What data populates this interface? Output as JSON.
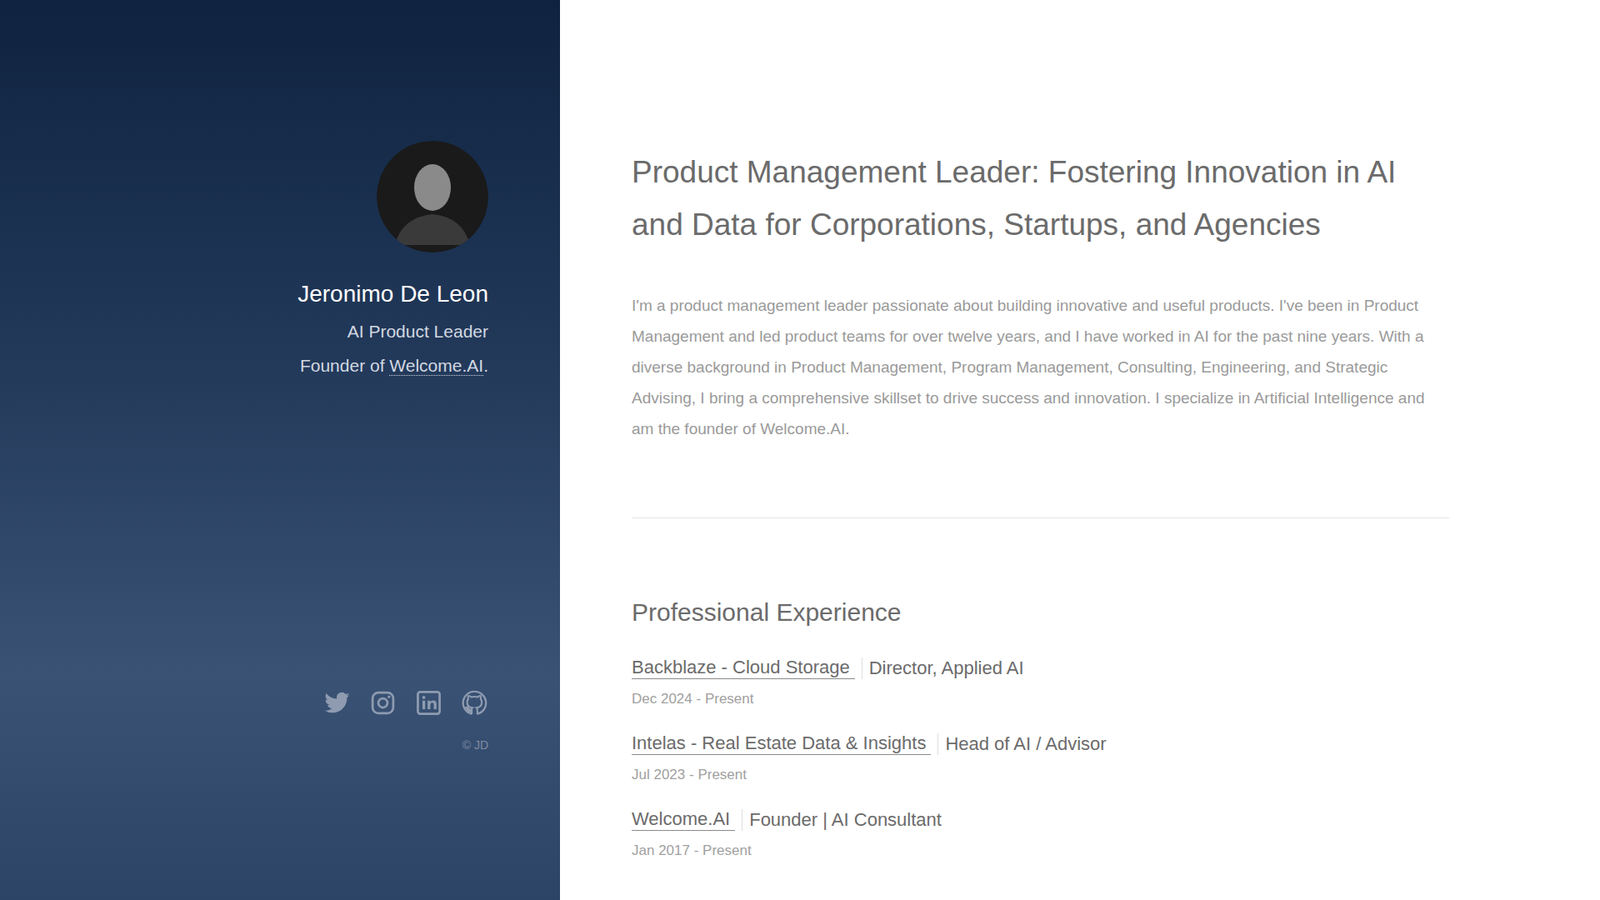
{
  "sidebar": {
    "name": "Jeronimo De Leon",
    "title": "AI Product Leader",
    "founder": {
      "prefix": "Founder of ",
      "link": "Welcome.AI",
      "suffix": "."
    },
    "copyright": "© JD"
  },
  "intro": {
    "heading": "Product Management Leader: Fostering Innovation in AI and Data for Corporations, Startups, and Agencies",
    "text": "I'm a product management leader passionate about building innovative and useful products. I've been in Product Management and led product teams for over twelve years, and I have worked in AI for the past nine years. With a diverse background in Product Management, Program Management, Consulting, Engineering, and Strategic Advising, I bring a comprehensive skillset to drive success and innovation. I specialize in Artificial Intelligence and am the founder of Welcome.AI."
  },
  "experience": {
    "title": "Professional Experience",
    "items": [
      {
        "company": "Backblaze - Cloud Storage",
        "role": "Director, Applied AI",
        "dates": "Dec 2024 - Present"
      },
      {
        "company": "Intelas - Real Estate Data & Insights",
        "role": "Head of AI / Advisor",
        "dates": "Jul 2023 - Present"
      },
      {
        "company": "Welcome.AI",
        "role": "Founder | AI Consultant",
        "dates": "Jan 2017 - Present"
      }
    ]
  }
}
